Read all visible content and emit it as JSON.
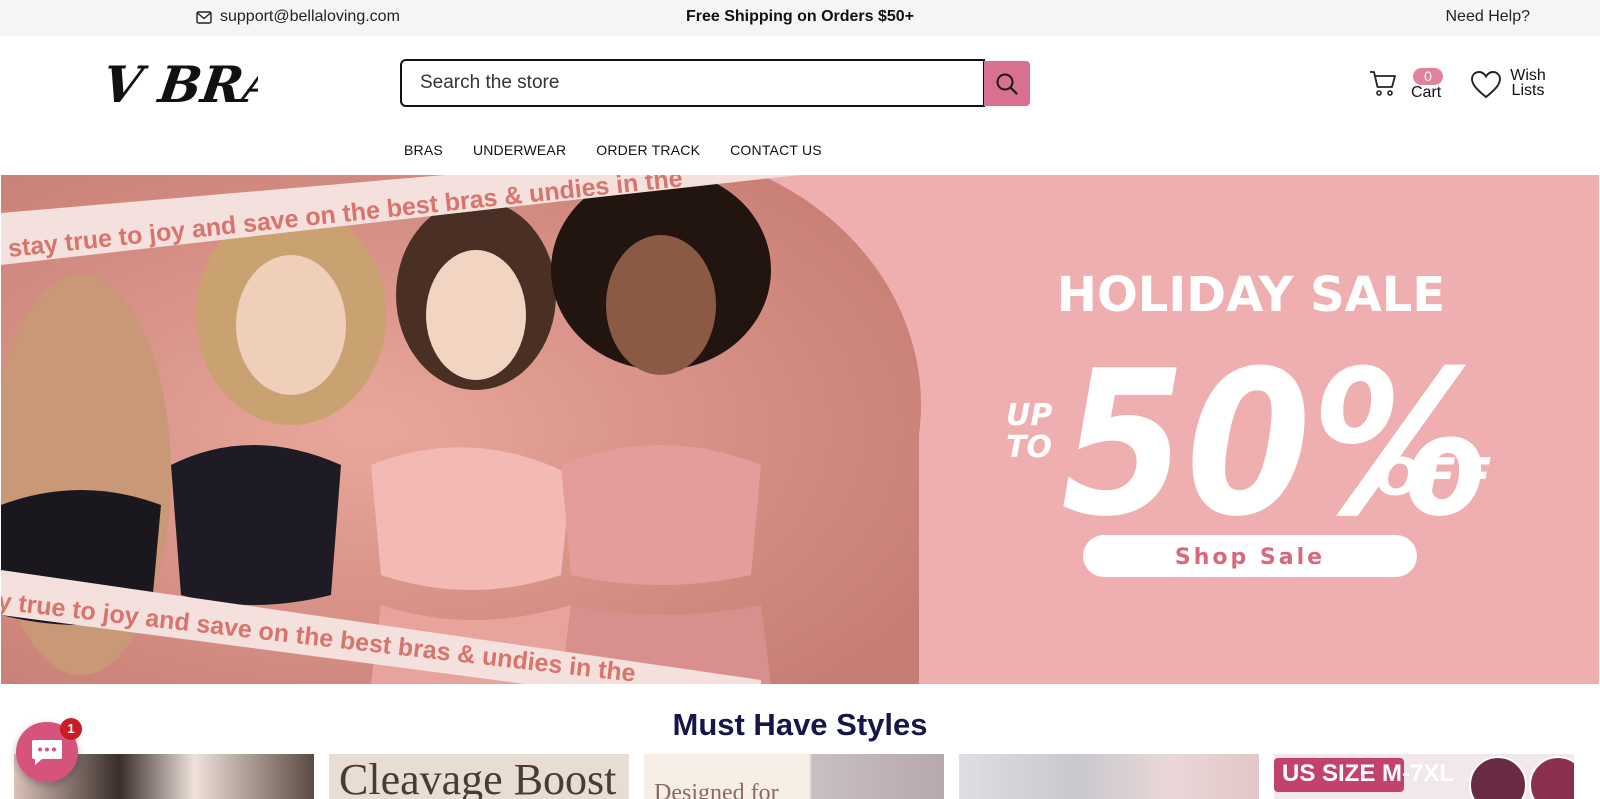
{
  "topbar": {
    "email": "support@bellaloving.com",
    "shipping": "Free Shipping on Orders $50+",
    "help": "Need Help?"
  },
  "header": {
    "logo_text": "V BRAS",
    "search_placeholder": "Search the store",
    "cart_count": "0",
    "cart_label": "Cart",
    "wish_line1": "Wish",
    "wish_line2": "Lists"
  },
  "nav": {
    "items": [
      "BRAS",
      "UNDERWEAR",
      "ORDER TRACK",
      "CONTACT US"
    ]
  },
  "hero": {
    "ribbon_text": "stay true to joy and save on the best bras & undies in the",
    "headline": "HOLIDAY SALE",
    "up_to_line1": "UP",
    "up_to_line2": "TO",
    "discount": "50%",
    "off": "OFF",
    "cta": "Shop  Sale"
  },
  "section": {
    "title": "Must Have Styles"
  },
  "cards": {
    "card2_text": "Cleavage Boost",
    "card3_text": "Designed for",
    "card5_text": "US SIZE M-7XL"
  },
  "chat": {
    "badge": "1"
  },
  "colors": {
    "accent_pink": "#d9708f",
    "hero_bg": "#efafb0",
    "badge_pink": "#e0829b",
    "heading_navy": "#16164a",
    "chat_pink": "#d6547c"
  },
  "icons": [
    "mail-icon",
    "search-icon",
    "cart-icon",
    "heart-icon",
    "chat-icon"
  ]
}
